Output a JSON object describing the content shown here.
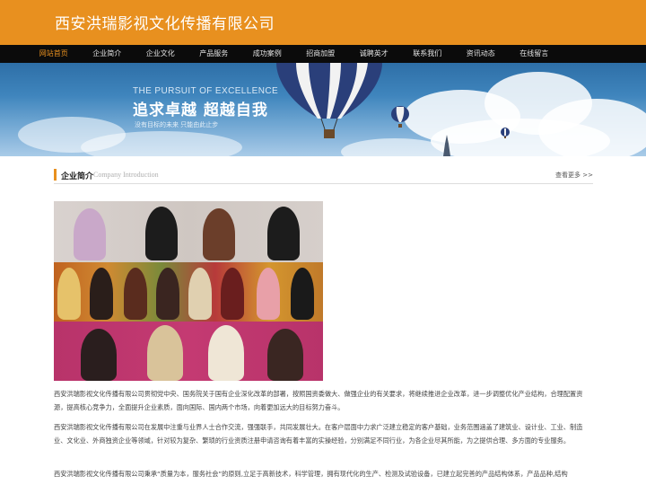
{
  "header": {
    "title": "西安洪瑞影视文化传播有限公司"
  },
  "nav": {
    "items": [
      {
        "label": "网站首页",
        "active": true
      },
      {
        "label": "企业简介"
      },
      {
        "label": "企业文化"
      },
      {
        "label": "产品服务"
      },
      {
        "label": "成功案例"
      },
      {
        "label": "招商加盟"
      },
      {
        "label": "诚聘英才"
      },
      {
        "label": "联系我们"
      },
      {
        "label": "资讯动态"
      },
      {
        "label": "在线留言"
      }
    ]
  },
  "banner": {
    "slogan_en": "THE PURSUIT OF EXCELLENCE",
    "slogan_cn": "追求卓越  超越自我",
    "slogan_sub": "没有目标的未来  只能由此止步"
  },
  "section": {
    "title": "企业简介",
    "subtitle": "Company Introduction",
    "more": "查看更多 >>"
  },
  "paragraphs": [
    "西安洪瑞影视文化传播有限公司贯彻党中央、国务院关于国有企业深化改革的部署，按照国资委做大、做强企业的有关要求，将继续推进企业改革，进一步调整优化产业结构，合理配置资源，提高核心竞争力，全面提升企业素质，面向国际、国内两个市场，向着更加远大的目标努力奋斗。",
    "西安洪瑞影视文化传播有限公司在发展中注重与业界人士合作交流，强强联手，共同发展壮大。在客户层面中力求广泛建立稳定的客户基础，业务范围涵盖了建筑业、设计业、工业、制造业、文化业、外商独资企业等领域，针对较为复杂、繁琐的行业资质注册申请咨询有着丰富的实操经验，分别满足不同行业，为各企业尽其所能，为之提供合理、多方面的专业服务。",
    "西安洪瑞影视文化传播有限公司秉承“质量为本，服务社会”的原则,立足于高新技术，科学管理，拥有现代化的生产、检测及试验设备，已建立起完善的产品结构体系，产品品种,结构"
  ],
  "colors": {
    "accent": "#e8901f",
    "nav_bg": "#0b0b0b"
  },
  "icons": [
    "hot-air-balloon-icon",
    "cloud-icon",
    "tower-icon"
  ]
}
